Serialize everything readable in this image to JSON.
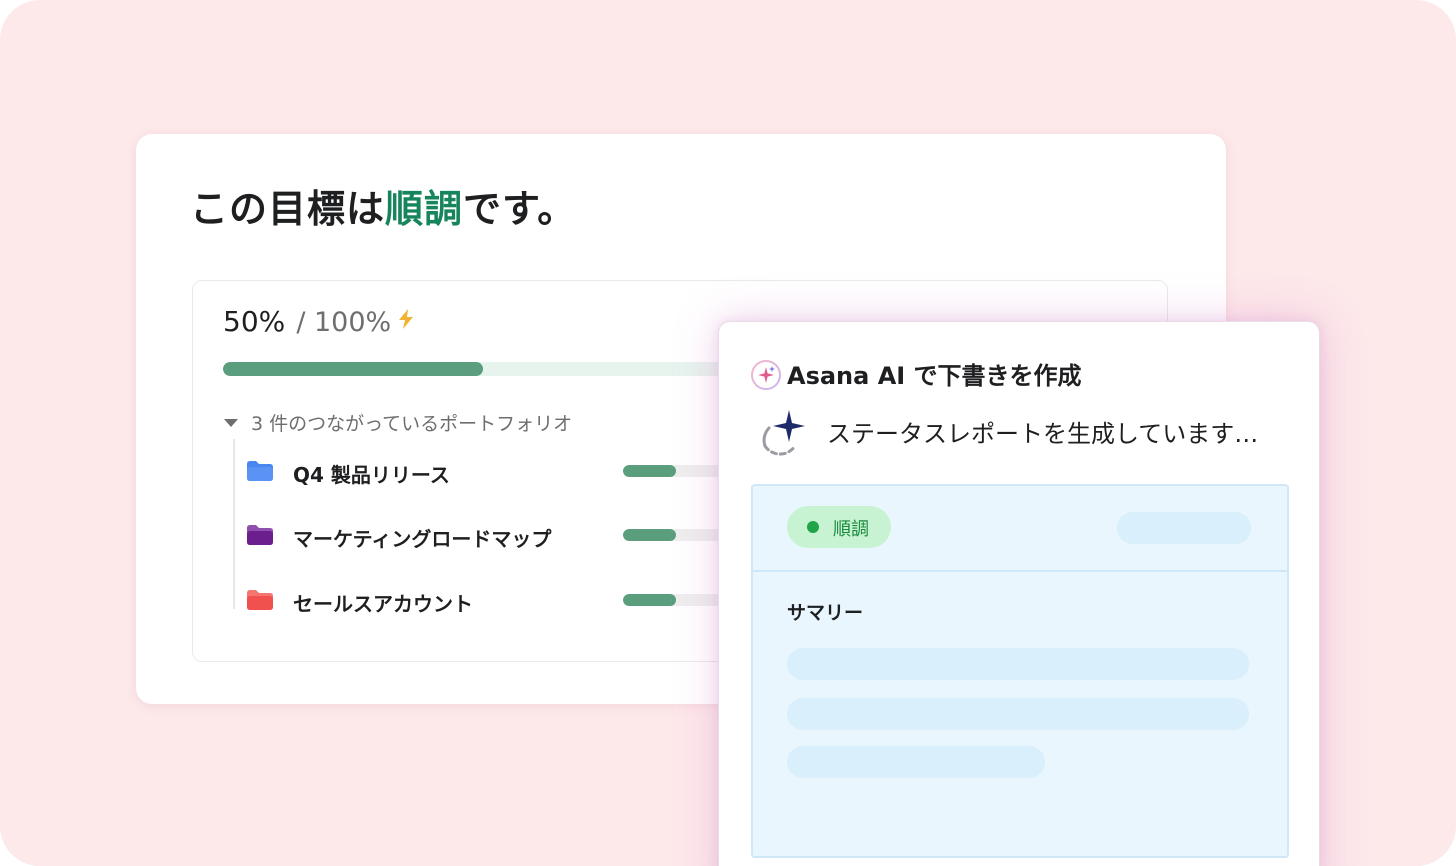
{
  "goal": {
    "title_prefix": "この目標は",
    "title_status": "順調",
    "title_suffix": "です。",
    "progress": {
      "current_label": "50%",
      "total_label": "/ 100%",
      "fraction": 0.5
    },
    "portfolios": {
      "toggle_label": "3 件のつながっているポートフォリオ",
      "items": [
        {
          "name": "Q4 製品リリース",
          "folder_color": "#4a86f0",
          "progress": 0.38
        },
        {
          "name": "マーケティングロードマップ",
          "folder_color": "#6b1e8e",
          "progress": 0.38
        },
        {
          "name": "セールスアカウント",
          "folder_color": "#f0514f",
          "progress": 0.38
        }
      ]
    }
  },
  "ai_panel": {
    "title": "Asana AI で下書きを作成",
    "generating_text": "ステータスレポートを生成しています…",
    "report": {
      "status_label": "順調",
      "summary_label": "サマリー"
    }
  },
  "colors": {
    "background": "#fde8ea",
    "accent_green": "#16855b",
    "progress_green": "#5a9e7e",
    "report_bg": "#e9f6fd",
    "status_pill": "#c8f3d3"
  },
  "icons": [
    "lightning-icon",
    "caret-down-icon",
    "folder-icon",
    "asana-ai-icon",
    "sparkle-spinner-icon"
  ]
}
